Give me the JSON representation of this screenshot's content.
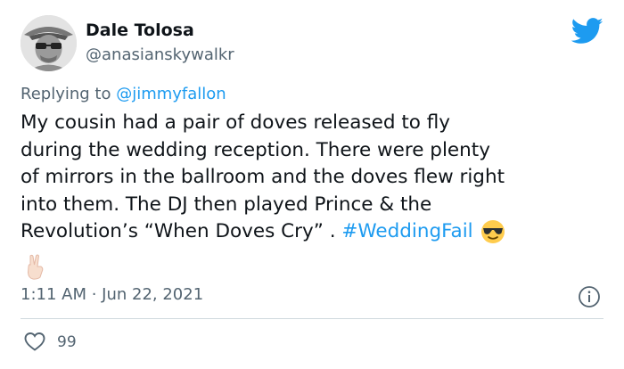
{
  "author": {
    "name": "Dale Tolosa",
    "handle": "@anasianskywalkr"
  },
  "reply": {
    "prefix": "Replying to ",
    "mention": "@jimmyfallon"
  },
  "tweet": {
    "text_line1": "My cousin had a pair of doves released to fly",
    "text_line2": "during the wedding reception. There were plenty",
    "text_line3": "of mirrors in the ballroom and the doves flew right",
    "text_line4": "into them. The DJ then played Prince & the",
    "text_line5": "Revolution’s “When Doves Cry” . ",
    "hashtag": "#WeddingFail",
    "timestamp": "1:11 AM · Jun 22, 2021"
  },
  "engagement": {
    "likes": "99"
  },
  "icons": {
    "brand": "twitter-bird-icon",
    "emoji1": "sunglasses-face-emoji",
    "emoji2": "victory-hand-emoji",
    "info": "info-icon",
    "like": "heart-icon"
  },
  "colors": {
    "brand_blue": "#1d9bf0",
    "secondary_text": "#536471",
    "primary_text": "#0f1419",
    "divider": "#cfd9de"
  }
}
